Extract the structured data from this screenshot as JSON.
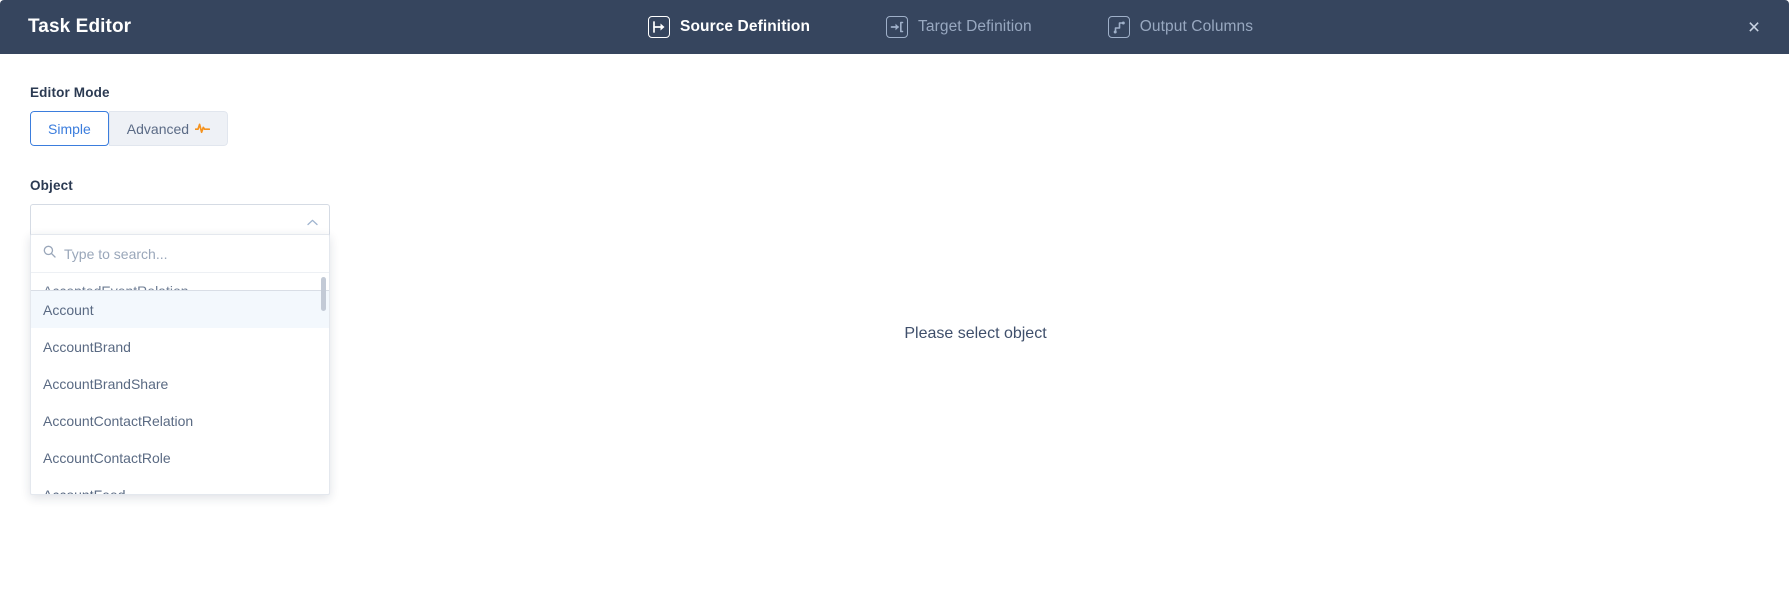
{
  "header": {
    "title": "Task Editor",
    "tabs": [
      {
        "label": "Source Definition",
        "icon": "source-definition-icon",
        "active": true
      },
      {
        "label": "Target Definition",
        "icon": "target-definition-icon",
        "active": false
      },
      {
        "label": "Output Columns",
        "icon": "output-columns-icon",
        "active": false
      }
    ],
    "close_icon": "close-icon",
    "close_label": "×",
    "background_color": "#36455e",
    "active_tab_color": "#ffffff",
    "inactive_tab_color": "#98a8c0"
  },
  "editor_mode": {
    "label": "Editor Mode",
    "options": [
      {
        "label": "Simple",
        "selected": true,
        "icon": null
      },
      {
        "label": "Advanced",
        "selected": false,
        "icon": "pulse-icon"
      }
    ],
    "selected_color": "#3b7ddd",
    "pulse_icon_color": "#f5921e"
  },
  "object_field": {
    "label": "Object",
    "value": "",
    "placeholder": "",
    "caret_icon": "chevron-up-icon",
    "expanded": true
  },
  "dropdown": {
    "search": {
      "placeholder": "Type to search...",
      "value": "",
      "icon": "search-icon"
    },
    "options": [
      {
        "label": "AcceptedEventRelation",
        "highlighted": false,
        "clipped": true
      },
      {
        "label": "Account",
        "highlighted": true,
        "clipped": false
      },
      {
        "label": "AccountBrand",
        "highlighted": false,
        "clipped": false
      },
      {
        "label": "AccountBrandShare",
        "highlighted": false,
        "clipped": false
      },
      {
        "label": "AccountContactRelation",
        "highlighted": false,
        "clipped": false
      },
      {
        "label": "AccountContactRole",
        "highlighted": false,
        "clipped": false
      },
      {
        "label": "AccountFeed",
        "highlighted": false,
        "clipped": false
      }
    ],
    "highlight_color": "#f3f8fd",
    "scrollbar_visible": true
  },
  "main": {
    "placeholder_text": "Please select object"
  }
}
